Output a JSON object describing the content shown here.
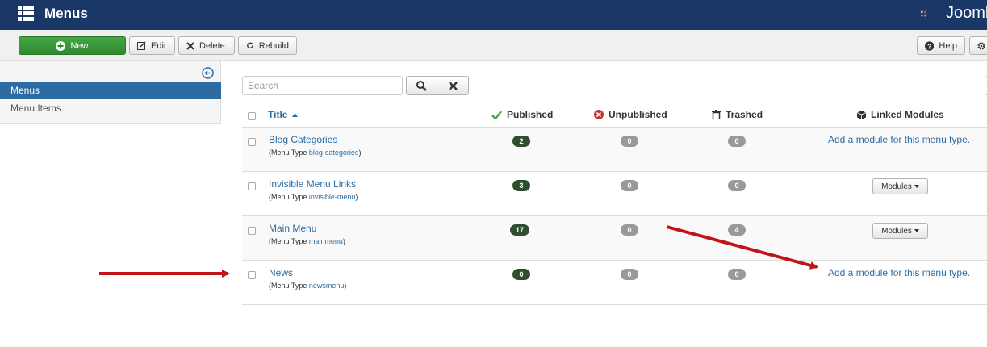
{
  "header": {
    "title": "Menus",
    "logo_text": "Joomla!"
  },
  "toolbar": {
    "new": "New",
    "edit": "Edit",
    "delete": "Delete",
    "rebuild": "Rebuild",
    "help": "Help"
  },
  "sidebar": {
    "items": [
      {
        "label": "Menus",
        "active": true
      },
      {
        "label": "Menu Items",
        "active": false
      }
    ]
  },
  "search": {
    "placeholder": "Search"
  },
  "table": {
    "headers": {
      "title": "Title",
      "published": "Published",
      "unpublished": "Unpublished",
      "trashed": "Trashed",
      "linked": "Linked Modules"
    },
    "menu_type_prefix": "(Menu Type",
    "rows": [
      {
        "name": "Blog Categories",
        "type": "blog-categories",
        "published": "2",
        "unpublished": "0",
        "trashed": "0",
        "linked": "Add a module for this menu type."
      },
      {
        "name": "Invisible Menu Links",
        "type": "invisible-menu",
        "published": "3",
        "unpublished": "0",
        "trashed": "0",
        "linked": "Modules"
      },
      {
        "name": "Main Menu",
        "type": "mainmenu",
        "published": "17",
        "unpublished": "0",
        "trashed": "4",
        "linked": "Modules"
      },
      {
        "name": "News",
        "type": "newsmenu",
        "published": "0",
        "unpublished": "0",
        "trashed": "0",
        "linked": "Add a module for this menu type."
      }
    ]
  },
  "colors": {
    "header_bg": "#1a3867",
    "new_button": "#46a546",
    "link": "#2d6ca2",
    "annotation_arrow": "#c0141a"
  }
}
